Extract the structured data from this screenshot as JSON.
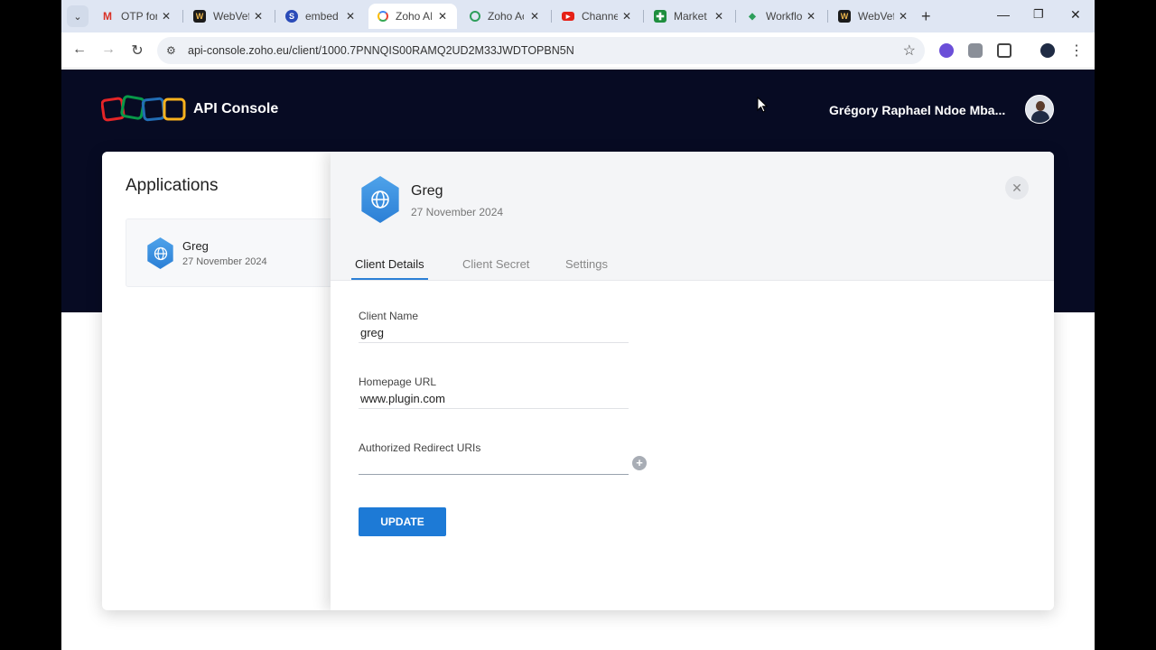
{
  "browser": {
    "tabs": [
      {
        "title": "OTP for",
        "favicon": "gmail-icon",
        "color": "#ffffff"
      },
      {
        "title": "WebVef",
        "favicon": "webvef-icon",
        "color": "#1b1b1b"
      },
      {
        "title": "embed",
        "favicon": "s-icon",
        "color": "#2a4bb8"
      },
      {
        "title": "Zoho AI",
        "favicon": "google-icon",
        "color": "#ffffff",
        "active": true
      },
      {
        "title": "Zoho Ac",
        "favicon": "zoho-accounts-icon",
        "color": "#ffffff"
      },
      {
        "title": "Channe",
        "favicon": "youtube-icon",
        "color": "#e62117"
      },
      {
        "title": "Market",
        "favicon": "sheets-icon",
        "color": "#1e8e3e"
      },
      {
        "title": "Workflo",
        "favicon": "workflow-icon",
        "color": "#ffffff"
      },
      {
        "title": "WebVef",
        "favicon": "webvef-icon",
        "color": "#1b1b1b"
      }
    ],
    "close_glyph": "✕",
    "new_tab_glyph": "+",
    "url": "api-console.zoho.eu/client/1000.7PNNQIS00RAMQ2UD2M33JWDTOPBN5N"
  },
  "header": {
    "brand": "API Console",
    "user_name": "Grégory Raphael Ndoe Mba..."
  },
  "applications": {
    "title": "Applications",
    "items": [
      {
        "name": "Greg",
        "date": "27 November 2024"
      }
    ]
  },
  "panel": {
    "app_name": "Greg",
    "app_date": "27 November 2024",
    "tabs": [
      "Client Details",
      "Client Secret",
      "Settings"
    ],
    "active_tab": "Client Details",
    "fields": {
      "client_name_label": "Client Name",
      "client_name_value": "greg",
      "homepage_label": "Homepage URL",
      "homepage_value": "www.plugin.com",
      "redirect_label": "Authorized Redirect URIs",
      "redirect_value": ""
    },
    "update_label": "UPDATE"
  },
  "colors": {
    "banner": "#070b23",
    "accent": "#1d7ad6"
  }
}
